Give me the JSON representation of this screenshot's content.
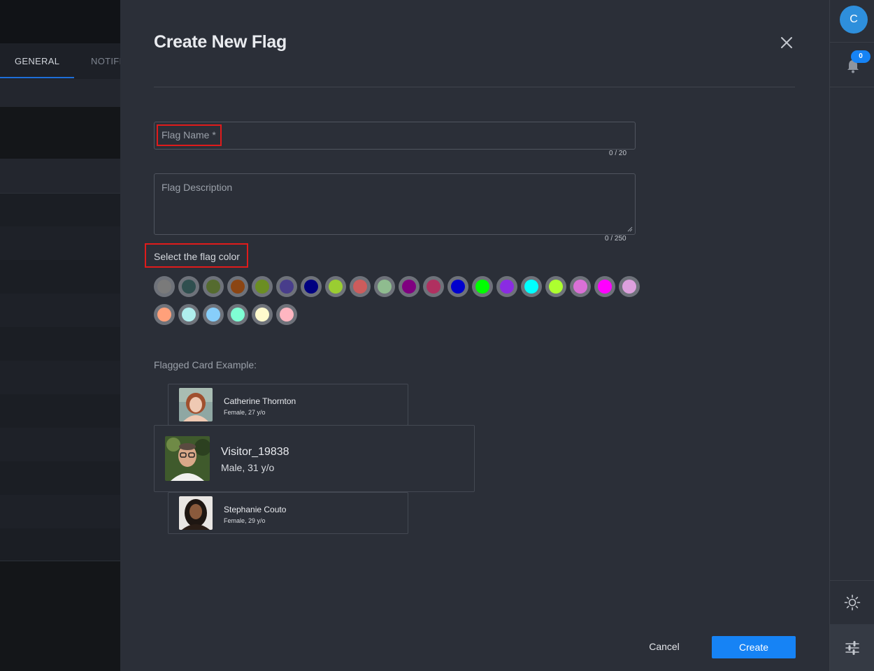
{
  "background": {
    "tabs": [
      {
        "label": "GENERAL"
      },
      {
        "label": "NOTIFI"
      }
    ]
  },
  "modal": {
    "title": "Create New Flag",
    "flag_name": {
      "label": "Flag Name *",
      "value": "",
      "counter": "0 / 20"
    },
    "flag_description": {
      "label": "Flag Description",
      "value": "",
      "counter": "0 / 250"
    },
    "color_label": "Select the flag color",
    "colors": [
      "#7a7a7a",
      "#2f4f4f",
      "#556b2f",
      "#8b4513",
      "#6b8e23",
      "#483d8b",
      "#000080",
      "#9acd32",
      "#cd5c5c",
      "#8fbc8f",
      "#800080",
      "#b03060",
      "#0000cd",
      "#00ff00",
      "#8a2be2",
      "#00ffff",
      "#adff2f",
      "#da70d6",
      "#ff00ff",
      "#dda0dd",
      "#ffa07a",
      "#afeeee",
      "#87cefa",
      "#7fffd4",
      "#fffacd",
      "#ffb6c1"
    ],
    "example_label": "Flagged Card Example:",
    "cards": [
      {
        "name": "Catherine Thornton",
        "sub": "Female, 27 y/o"
      },
      {
        "name": "Visitor_19838",
        "sub": "Male, 31 y/o"
      },
      {
        "name": "Stephanie Couto",
        "sub": "Female, 29 y/o"
      }
    ],
    "cancel_label": "Cancel",
    "create_label": "Create"
  },
  "rail": {
    "user_initial": "C",
    "notifications_count": "0"
  }
}
